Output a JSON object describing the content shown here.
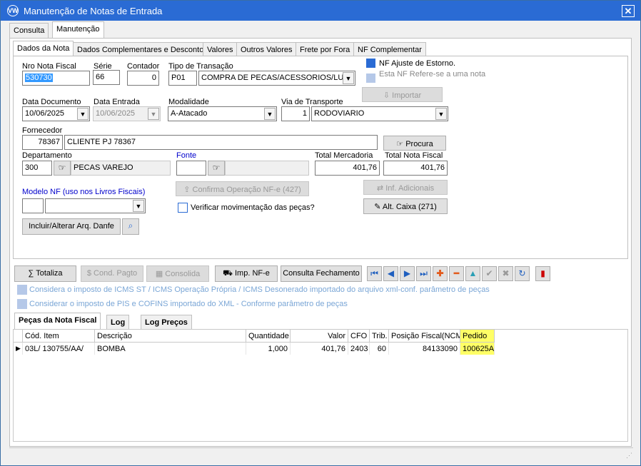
{
  "window": {
    "title": "Manutenção de Notas de Entrada",
    "logo": "VW",
    "close": "✕"
  },
  "outer_tabs": [
    "Consulta",
    "Manutenção"
  ],
  "inner_tabs": [
    "Dados da Nota",
    "Dados Complementares e Desconto",
    "Valores",
    "Outros Valores",
    "Frete por Fora",
    "NF Complementar"
  ],
  "form": {
    "nro_label": "Nro Nota Fiscal",
    "nro": "530730",
    "serie_label": "Série",
    "serie": "66",
    "contador_label": "Contador",
    "contador": "0",
    "tipo_label": "Tipo de Transação",
    "tipo_code": "P01",
    "tipo_desc": "COMPRA DE PECAS/ACESSORIOS/LUBRI",
    "estorno_label": "NF Ajuste  de Estorno.",
    "refere_label": "Esta NF Refere-se a uma nota",
    "importar": "Importar",
    "data_doc_label": "Data Documento",
    "data_doc": "10/06/2025",
    "data_ent_label": "Data Entrada",
    "data_ent": "10/06/2025",
    "modalidade_label": "Modalidade",
    "modalidade": "A-Atacado",
    "via_label": "Via de Transporte",
    "via_code": "1",
    "via_desc": "RODOVIARIO",
    "fornecedor_label": "Fornecedor",
    "fornecedor_code": "78367",
    "fornecedor_nome": "CLIENTE PJ 78367",
    "procura": "Procura",
    "departamento_label": "Departamento",
    "departamento_code": "300",
    "departamento_nome": "PECAS VAREJO",
    "fonte_label": "Fonte",
    "total_merc_label": "Total Mercadoria",
    "total_merc": "401,76",
    "total_nf_label": "Total Nota Fiscal",
    "total_nf": "401,76",
    "confirma": "Confirma Operação NF-e (427)",
    "inf_adic": "Inf. Adicionais",
    "modelo_label": "Modelo NF (uso nos Livros Fiscais)",
    "verificar_label": "Verificar movimentação das peças?",
    "alt_caixa": "Alt. Caixa (271)",
    "incluir": "Incluir/Alterar Arq. Danfe"
  },
  "toolbar": {
    "totaliza": "Totaliza",
    "cond_pagto": "Cond. Pagto",
    "consolida": "Consolida",
    "imp_nfe": "Imp. NF-e",
    "consulta_fech": "Consulta Fechamento"
  },
  "notes": [
    "Considera o imposto de ICMS ST / ICMS Operação Própria / ICMS Desonerado importado do arquivo xml-conf. parâmetro de peças",
    "Considerar o imposto de PIS e COFINS importado do XML - Conforme parâmetro de peças"
  ],
  "bottom_tabs": [
    "Peças da Nota Fiscal",
    "Log",
    "Log Preços"
  ],
  "grid": {
    "headers": [
      "Cód. Item",
      "Descrição",
      "Quantidade",
      "Valor",
      "CFO",
      "Trib.",
      "Posição Fiscal(NCM)",
      "Pedido"
    ],
    "rows": [
      [
        "03L/  130755/AA/",
        "BOMBA",
        "1,000",
        "401,76",
        "2403",
        "60",
        "84133090",
        "100625A"
      ]
    ]
  },
  "colors": {
    "title_bar": "#2a6bd4",
    "highlight": "#ffff66",
    "selection": "#3399ff"
  }
}
